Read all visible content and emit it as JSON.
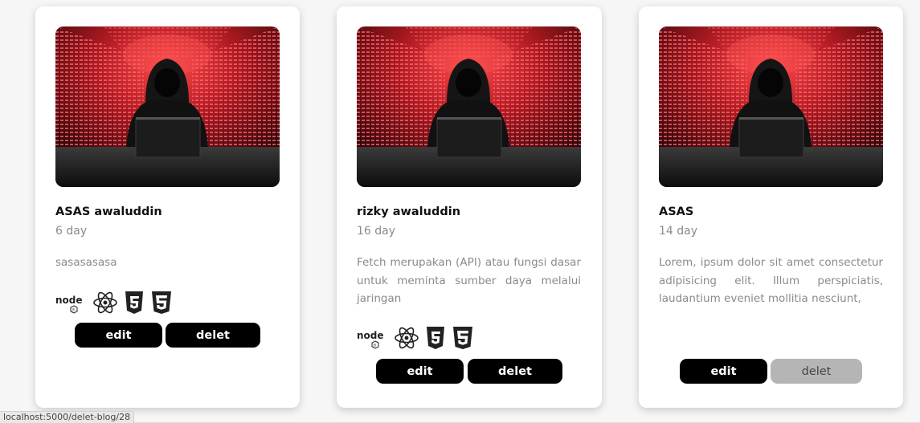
{
  "cards": [
    {
      "title": "ASAS awaluddin",
      "age": "6 day",
      "description": "sasasasasa",
      "tech_icons": [
        "nodejs-icon",
        "react-icon",
        "html5-icon",
        "css3-icon"
      ],
      "edit_label": "edit",
      "delete_label": "delet",
      "delete_disabled": false
    },
    {
      "title": "rizky awaluddin",
      "age": "16 day",
      "description": "Fetch merupakan (API) atau fungsi dasar untuk meminta sumber daya melalui jaringan",
      "tech_icons": [
        "nodejs-icon",
        "react-icon",
        "html5-icon",
        "css3-icon"
      ],
      "edit_label": "edit",
      "delete_label": "delet",
      "delete_disabled": false
    },
    {
      "title": "ASAS",
      "age": "14 day",
      "description": "Lorem, ipsum dolor sit amet consectetur adipisicing elit. Illum perspiciatis, laudantium eveniet mollitia nesciunt,",
      "tech_icons": [],
      "edit_label": "edit",
      "delete_label": "delet",
      "delete_disabled": true
    }
  ],
  "status_bar": {
    "url": "localhost:5000/delet-blog/28"
  },
  "colors": {
    "button_bg": "#000000",
    "button_disabled_bg": "#b5b5b5",
    "muted_text": "#8a8a8a",
    "card_bg": "#ffffff"
  }
}
